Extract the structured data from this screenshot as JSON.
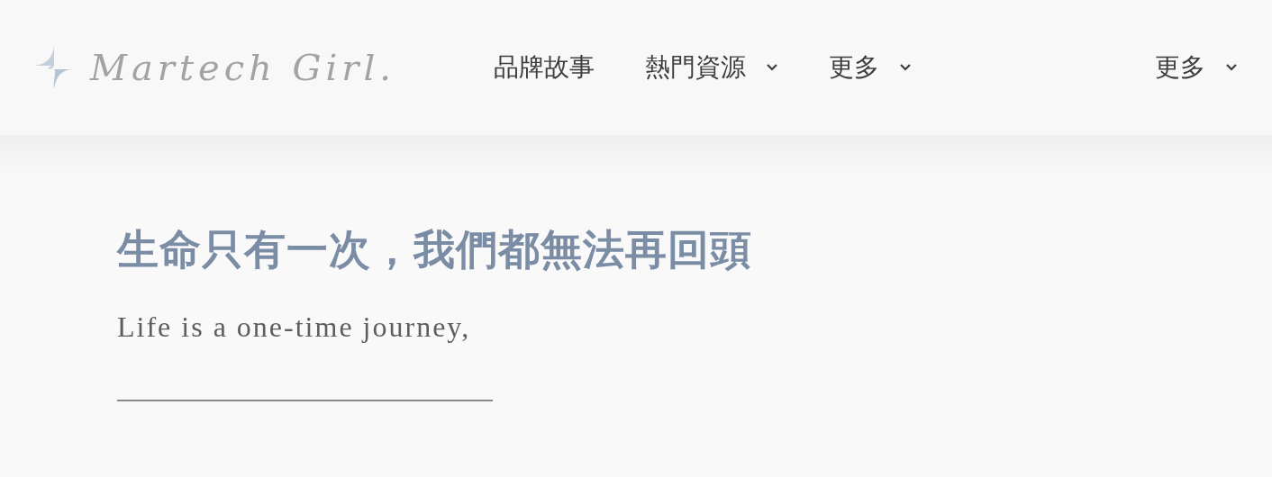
{
  "header": {
    "logo": {
      "text": "Martech Girl."
    },
    "nav": [
      {
        "label": "品牌故事",
        "has_menu": false
      },
      {
        "label": "熱門資源",
        "has_menu": true
      },
      {
        "label": "更多",
        "has_menu": true
      }
    ],
    "nav_right": [
      {
        "label": "更多",
        "has_menu": true
      }
    ]
  },
  "hero": {
    "title": "生命只有一次，我們都無法再回頭",
    "subtitle": "Life is a one-time journey,"
  }
}
